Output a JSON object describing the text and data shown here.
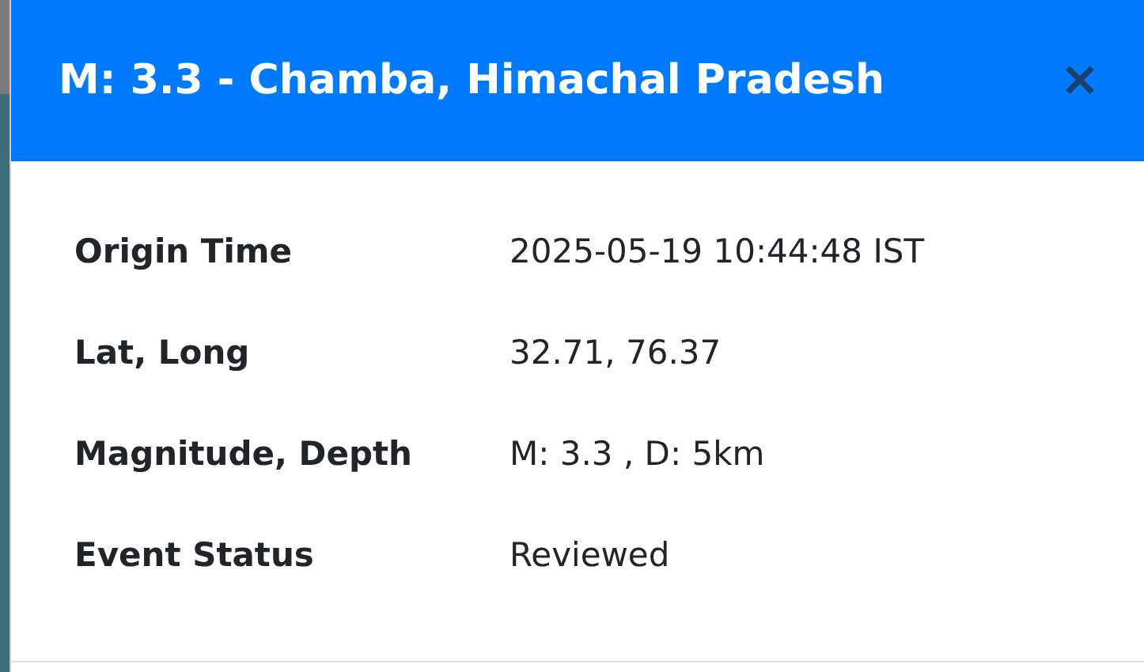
{
  "modal": {
    "title": "M: 3.3 - Chamba, Himachal Pradesh",
    "close": "×"
  },
  "details": [
    {
      "label": "Origin Time",
      "value": "2025-05-19 10:44:48 IST"
    },
    {
      "label": "Lat, Long",
      "value": "32.71, 76.37"
    },
    {
      "label": "Magnitude, Depth",
      "value": "M: 3.3 , D: 5km"
    },
    {
      "label": "Event Status",
      "value": "Reviewed"
    }
  ]
}
